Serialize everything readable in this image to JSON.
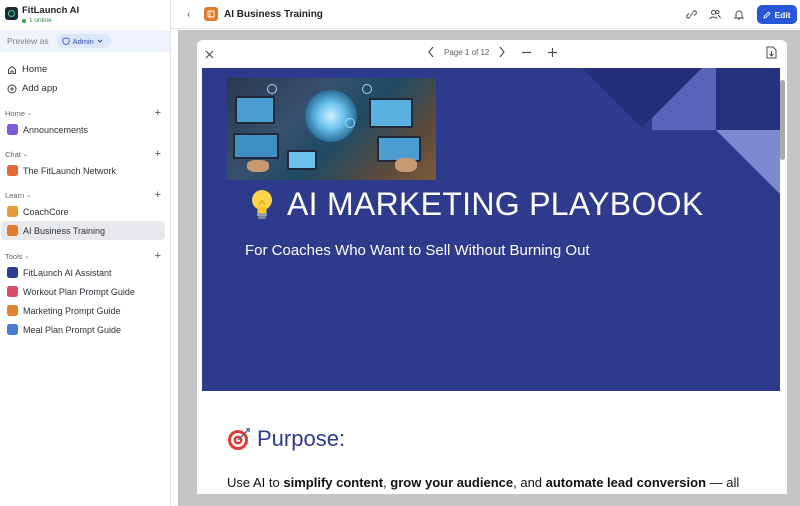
{
  "org": {
    "name": "FitLaunch AI",
    "status": "1 online"
  },
  "preview": {
    "label": "Preview as",
    "role": "Admin"
  },
  "nav": [
    {
      "label": "Home",
      "icon": "home-icon"
    },
    {
      "label": "Add app",
      "icon": "add-circle-icon"
    }
  ],
  "sections": {
    "home": {
      "title": "Home",
      "items": [
        {
          "label": "Announcements",
          "color": "#7d5bd6"
        }
      ]
    },
    "chat": {
      "title": "Chat",
      "items": [
        {
          "label": "The FitLaunch Network",
          "color": "#e8673a"
        }
      ]
    },
    "learn": {
      "title": "Learn",
      "items": [
        {
          "label": "CoachCore",
          "color": "#e39b3a"
        },
        {
          "label": "AI Business Training",
          "color": "#e07b2e"
        }
      ]
    },
    "tools": {
      "title": "Tools",
      "items": [
        {
          "label": "FitLaunch AI Assistant",
          "color": "#2a3f8f"
        },
        {
          "label": "Workout Plan Prompt Guide",
          "color": "#d94d6a"
        },
        {
          "label": "Marketing Prompt Guide",
          "color": "#e1842d"
        },
        {
          "label": "Meal Plan Prompt Guide",
          "color": "#4a7bd1"
        }
      ]
    }
  },
  "header": {
    "title": "AI Business Training",
    "edit_label": "Edit"
  },
  "viewer": {
    "page_label": "Page 1 of 12"
  },
  "document": {
    "cover_title": "AI MARKETING PLAYBOOK",
    "cover_subtitle": "For Coaches Who Want to Sell Without Burning Out",
    "purpose_heading": "Purpose:",
    "purpose_pre": "Use AI to ",
    "purpose_b1": "simplify content",
    "purpose_sep1": ", ",
    "purpose_b2": "grow your audience",
    "purpose_sep2": ", and ",
    "purpose_b3": "automate lead conversion",
    "purpose_post": " — all"
  },
  "colors": {
    "accent": "#2756d6",
    "cover": "#2e3a8c",
    "active_item": "#e8e9ec"
  }
}
